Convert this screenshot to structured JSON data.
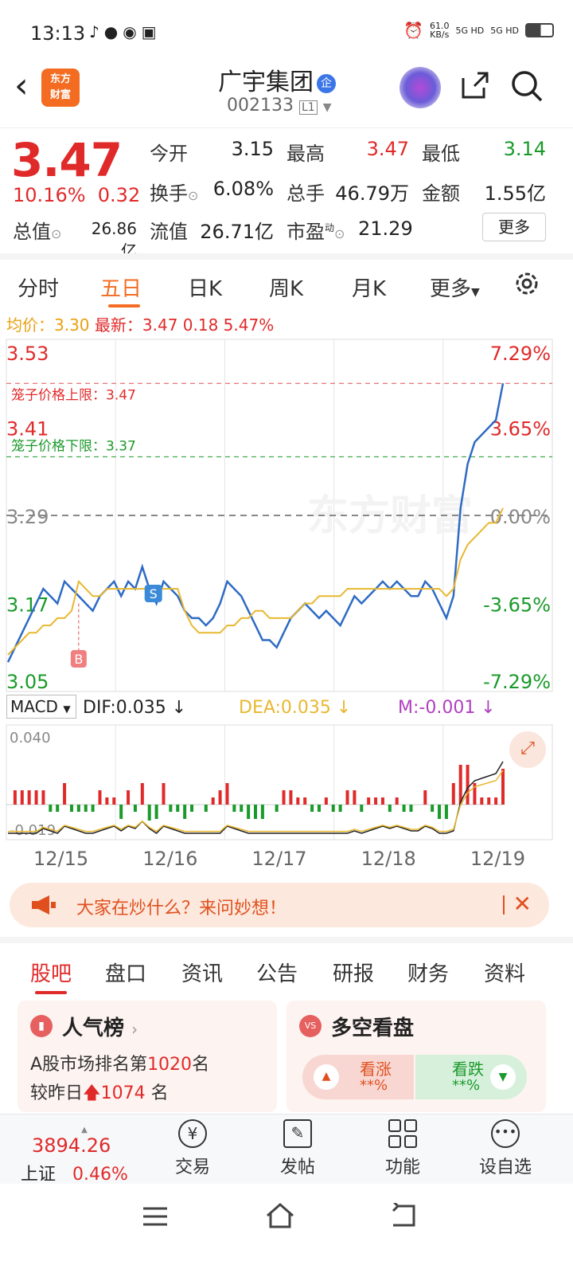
{
  "status": {
    "time": "13:13",
    "speed": "61.0",
    "speed_unit": "KB/s",
    "net1": "5G HD",
    "net2": "5G HD"
  },
  "header": {
    "logo_line1": "东方",
    "logo_line2": "财富",
    "name": "广宇集团",
    "badge": "企",
    "code": "002133",
    "level": "L1"
  },
  "quote": {
    "price": "3.47",
    "change_pct": "10.16%",
    "change_abs": "0.32",
    "open_label": "今开",
    "open": "3.15",
    "high_label": "最高",
    "high": "3.47",
    "low_label": "最低",
    "low": "3.14",
    "turnover_label": "换手",
    "turnover": "6.08%",
    "volume_label": "总手",
    "volume": "46.79万",
    "amount_label": "金额",
    "amount": "1.55亿",
    "mktcap_label": "总值",
    "mktcap": "26.86亿",
    "float_label": "流值",
    "float": "26.71亿",
    "pe_label": "市盈",
    "pe_sup": "动",
    "pe": "21.29",
    "more": "更多"
  },
  "tabs": [
    "分时",
    "五日",
    "日K",
    "周K",
    "月K",
    "更多"
  ],
  "avg": {
    "avg_label": "均价：",
    "avg": "3.30",
    "latest_label": "最新：",
    "latest": "3.47",
    "chg": "0.18",
    "pct": "5.47%"
  },
  "chart_data": {
    "type": "line",
    "title": "五日",
    "x": [
      "12/15",
      "12/16",
      "12/17",
      "12/18",
      "12/19"
    ],
    "ylim": [
      3.05,
      3.53
    ],
    "y_left_ticks": [
      "3.53",
      "3.41",
      "3.29",
      "3.17",
      "3.05"
    ],
    "y_right_ticks": [
      "7.29%",
      "3.65%",
      "0.00%",
      "-3.65%",
      "-7.29%"
    ],
    "upper_limit_label": "笼子价格上限：3.47",
    "lower_limit_label": "笼子价格下限：3.37",
    "upper_limit": 3.47,
    "lower_limit": 3.37,
    "prev_close": 3.29,
    "watermark": "东方财富",
    "marker_b": "B",
    "marker_s": "S",
    "series": [
      {
        "name": "price",
        "color": "#2e6bc4",
        "values": [
          3.09,
          3.11,
          3.13,
          3.15,
          3.17,
          3.19,
          3.18,
          3.17,
          3.2,
          3.19,
          3.18,
          3.17,
          3.16,
          3.18,
          3.19,
          3.2,
          3.18,
          3.2,
          3.19,
          3.22,
          3.19,
          3.17,
          3.2,
          3.19,
          3.18,
          3.16,
          3.15,
          3.15,
          3.14,
          3.15,
          3.17,
          3.2,
          3.19,
          3.18,
          3.16,
          3.14,
          3.12,
          3.12,
          3.11,
          3.13,
          3.15,
          3.16,
          3.17,
          3.16,
          3.15,
          3.16,
          3.15,
          3.14,
          3.16,
          3.18,
          3.17,
          3.18,
          3.19,
          3.2,
          3.19,
          3.2,
          3.19,
          3.18,
          3.18,
          3.2,
          3.19,
          3.17,
          3.15,
          3.18,
          3.3,
          3.36,
          3.39,
          3.4,
          3.41,
          3.42,
          3.47
        ]
      },
      {
        "name": "avg",
        "color": "#e8b830",
        "values": [
          3.1,
          3.11,
          3.12,
          3.13,
          3.13,
          3.14,
          3.14,
          3.15,
          3.15,
          3.16,
          3.2,
          3.19,
          3.18,
          3.18,
          3.19,
          3.19,
          3.19,
          3.19,
          3.19,
          3.19,
          3.19,
          3.19,
          3.19,
          3.19,
          3.19,
          3.16,
          3.14,
          3.13,
          3.13,
          3.13,
          3.13,
          3.14,
          3.14,
          3.15,
          3.15,
          3.16,
          3.16,
          3.15,
          3.15,
          3.15,
          3.15,
          3.16,
          3.17,
          3.17,
          3.18,
          3.18,
          3.18,
          3.18,
          3.19,
          3.19,
          3.19,
          3.19,
          3.19,
          3.19,
          3.19,
          3.19,
          3.19,
          3.19,
          3.19,
          3.19,
          3.19,
          3.19,
          3.18,
          3.19,
          3.23,
          3.25,
          3.26,
          3.27,
          3.28,
          3.28,
          3.3
        ]
      }
    ],
    "macd": {
      "select": "MACD",
      "dif_label": "DIF:0.035 ↓",
      "dea_label": "DEA:0.035 ↓",
      "m_label": "M:-0.001 ↓",
      "ylim": [
        -0.019,
        0.04
      ],
      "top_tick": "0.040",
      "bottom_tick": "-0.019",
      "colors": {
        "dif": "#222222",
        "dea": "#e8b830",
        "m": "#b040c0",
        "up": "#e02a2a",
        "down": "#1a9a2a"
      }
    }
  },
  "banner": {
    "text": "大家在炒什么？来问妙想！"
  },
  "sections": [
    "股吧",
    "盘口",
    "资讯",
    "公告",
    "研报",
    "财务",
    "资料"
  ],
  "popularity": {
    "title": "人气榜",
    "rank_prefix": "A股市场排名第",
    "rank": "1020",
    "rank_suffix": "名",
    "vs_prefix": "较昨日",
    "vs": "1074",
    "vs_suffix": " 名"
  },
  "vote": {
    "title": "多空看盘",
    "up": "看涨",
    "up_pct": "**%",
    "down": "看跌",
    "down_pct": "**%"
  },
  "bottom": {
    "index_value": "3894.26",
    "index_name": "上证",
    "index_pct": "0.46%",
    "trade": "交易",
    "post": "发帖",
    "func": "功能",
    "watch": "设自选"
  }
}
